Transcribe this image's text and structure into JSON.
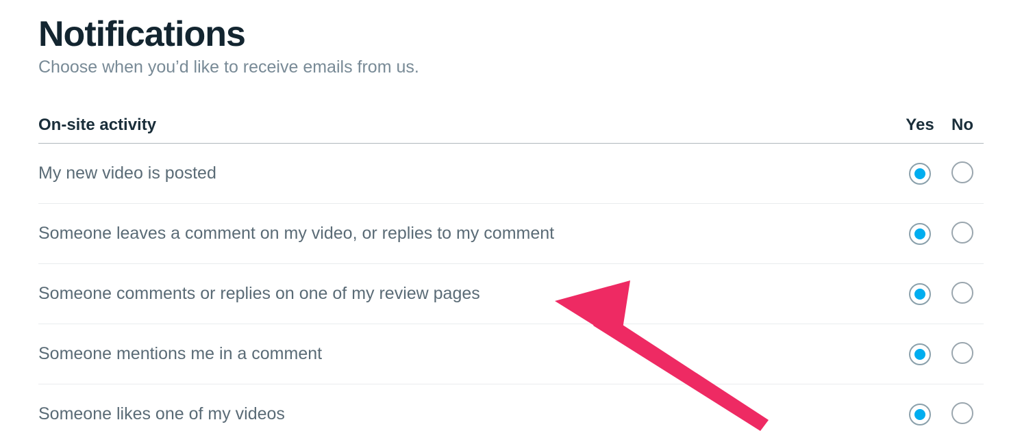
{
  "header": {
    "title": "Notifications",
    "subtitle": "Choose when you’d like to receive emails from us."
  },
  "columns": {
    "activity": "On-site activity",
    "yes": "Yes",
    "no": "No"
  },
  "rows": [
    {
      "label": "My new video is posted",
      "selected": "yes"
    },
    {
      "label": "Someone leaves a comment on my video, or replies to my comment",
      "selected": "yes"
    },
    {
      "label": "Someone comments or replies on one of my review pages",
      "selected": "yes"
    },
    {
      "label": "Someone mentions me in a comment",
      "selected": "yes"
    },
    {
      "label": "Someone likes one of my videos",
      "selected": "yes"
    }
  ],
  "annotation": {
    "arrow_color": "#ee2a63"
  }
}
